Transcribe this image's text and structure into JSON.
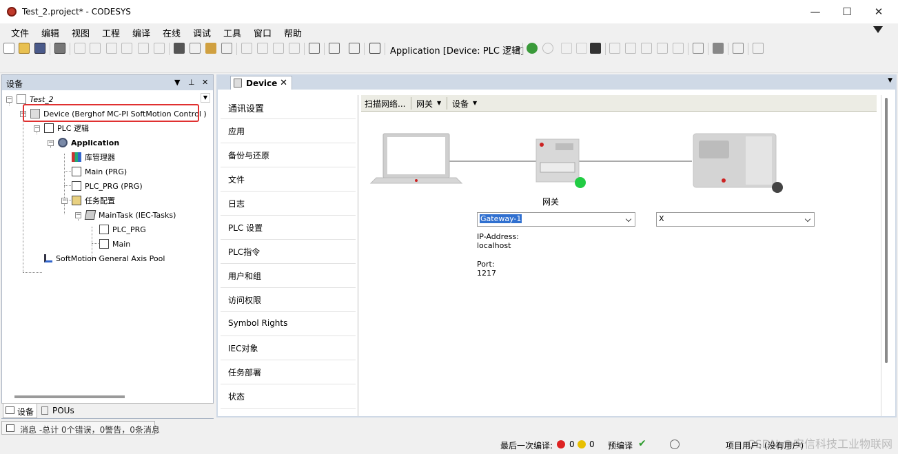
{
  "window": {
    "title": "Test_2.project* - CODESYS",
    "minimize_label": "—",
    "maximize_label": "☐",
    "close_label": "✕"
  },
  "menu": {
    "items": [
      "文件",
      "编辑",
      "视图",
      "工程",
      "编译",
      "在线",
      "调试",
      "工具",
      "窗口",
      "帮助"
    ]
  },
  "toolbar": {
    "application_selector": "Application [Device: PLC 逻辑]"
  },
  "devices_panel": {
    "title": "设备",
    "pin_label": "▼  ⊥  ✕",
    "tree": {
      "project": "Test_2",
      "device": "Device (Berghof MC-PI SoftMotion Control )",
      "plc_logic": "PLC 逻辑",
      "application": "Application",
      "library_manager": "库管理器",
      "main": "Main (PRG)",
      "plc_prg": "PLC_PRG (PRG)",
      "task_config": "任务配置",
      "main_task": "MainTask (IEC-Tasks)",
      "task_plc_prg": "PLC_PRG",
      "task_main": "Main",
      "axis_pool": "SoftMotion General Axis Pool"
    },
    "bottom_tabs": [
      "设备",
      "POUs"
    ]
  },
  "messages_bar": "消息 -总计 0个错误，0警告，0条消息",
  "status_bar": {
    "last_compile_label": "最后一次编译:",
    "errors": "0",
    "warnings": "0",
    "precompile_label": "预编译",
    "project_user": "项目用户: (没有用户)"
  },
  "editor": {
    "tab_label": "Device",
    "tab_close": "✕",
    "side_items": [
      "通讯设置",
      "应用",
      "备份与还原",
      "文件",
      "日志",
      "PLC 设置",
      "PLC指令",
      "用户和组",
      "访问权限",
      "Symbol Rights",
      "IEC对象",
      "任务部署",
      "状态"
    ],
    "content_toolbar": {
      "scan_network": "扫描网络...",
      "gateway_menu": "网关",
      "device_menu": "设备"
    },
    "gateway_caption": "网关",
    "gateway_combo_value": "Gateway-1",
    "device_combo_value": "X",
    "ip_address_label": "IP-Address:",
    "ip_address_value": "localhost",
    "port_label": "Port:",
    "port_value": "1217",
    "colors": {
      "gateway_status": "#22cc44",
      "device_status": "#444444",
      "highlight_border": "#e03030"
    }
  },
  "watermark": "CSDN @安信科技工业物联网"
}
